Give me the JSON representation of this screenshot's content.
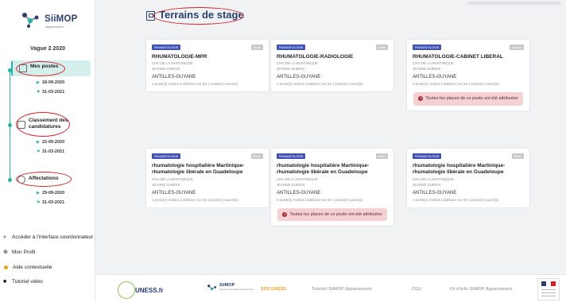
{
  "brand": {
    "name": "SiiMOP",
    "subtitle": "Appariement"
  },
  "sidebar": {
    "vague": "Vague 2 2020",
    "steps": [
      {
        "label": "Mes postes",
        "date_start": "18-09-2020",
        "date_end": "31-03-2021"
      },
      {
        "label": "Classement des candidatures",
        "date_start": "22-09-2020",
        "date_end": "31-03-2021"
      },
      {
        "label": "Affectations",
        "date_start": "29-09-2020",
        "date_end": "31-03-2021"
      }
    ],
    "bottom_links": [
      {
        "label": "Accéder à l'interface coordonnateur"
      },
      {
        "label": "Mon Profil"
      },
      {
        "label": "Aide contextuelle"
      },
      {
        "label": "Tutoriel vidéo"
      }
    ]
  },
  "main": {
    "title": "Terrains de stage",
    "cards": [
      {
        "specialty": "RHUMATOLOGIE",
        "mode": "Mode",
        "title": "RHUMATOLOGIE-MPR",
        "meta": [
          "CHU DE LA MARTINIQUE",
          "JEANNE DUBOIS"
        ],
        "region": "ANTILLES-GUYANE",
        "availability": "1 poste(s) restant à attribuer sur les 1 poste(s) ouvert(s)",
        "alert": ""
      },
      {
        "specialty": "RHUMATOLOGIE",
        "mode": "Mode",
        "title": "RHUMATOLOGIE-RADIOLOGIE",
        "meta": [
          "CHU DE LA MARTINIQUE",
          "JEANNE DUBOIS"
        ],
        "region": "ANTILLES-GUYANE",
        "availability": "1 poste(s) restant à attribuer sur les 1 poste(s) ouvert(s)",
        "alert": ""
      },
      {
        "specialty": "RHUMATOLOGIE",
        "mode": "Couple",
        "title": "RHUMATOLOGIE-CABINET LIBERAL",
        "meta": [
          "CHU DE LA MARTINIQUE",
          "JEANNE DUBOIS"
        ],
        "region": "ANTILLES-GUYANE",
        "availability": "0 poste(s) restant à attribuer sur les 1 poste(s) ouvert(s)",
        "alert": "Toutes les places de ce poste ont été attribuées"
      },
      {
        "specialty": "RHUMATOLOGIE",
        "mode": "Mode",
        "title": "rhumatologie hospitalière Martinique- rhumatologie libérale en Guadeloupe",
        "meta": [
          "CHU DE LA MARTINIQUE",
          "JEANNE DUBOIS"
        ],
        "region": "ANTILLES-GUYANE",
        "availability": "1 poste(s) restant à attribuer sur les 1 poste(s) ouvert(s)",
        "alert": ""
      },
      {
        "specialty": "RHUMATOLOGIE",
        "mode": "Mode",
        "title": "rhumatologie hospitalière Martinique- rhumatologie libérale en Guadeloupe",
        "meta": [
          "CHU DE LA MARTINIQUE",
          "JEANNE DUBOIS"
        ],
        "region": "ANTILLES-GUYANE",
        "availability": "0 poste(s) restant à attribuer sur les 1 poste(s) ouvert(s)",
        "alert": "Toutes les places de ce poste ont été attribuées"
      },
      {
        "specialty": "RHUMATOLOGIE",
        "mode": "Mode",
        "title": "rhumatologie hospitalière Martinique- rhumatologie libérale en Guadeloupe",
        "meta": [
          "CHU DE LA MARTINIQUE",
          "JEANNE DUBOIS"
        ],
        "region": "ANTILLES-GUYANE",
        "availability": "1 poste(s) restant à attribuer sur les 1 poste(s) ouvert(s)",
        "alert": ""
      }
    ]
  },
  "footer": {
    "uness": "UNESS.fr",
    "siimop": "SiiMOP",
    "siimop_sub": "Système Informatisé des Internats",
    "links": [
      "SOS UNESS",
      "Tutoriel SiiMOP Appariement",
      "CGU",
      "Fil d'info SiiMOP Appariement"
    ]
  },
  "colors": {
    "accent": "#28b3a6",
    "brand": "#2a3f6c",
    "highlight": "#d71f28",
    "tag": "#3f51b5",
    "alert_bg": "#f6d1d3"
  }
}
